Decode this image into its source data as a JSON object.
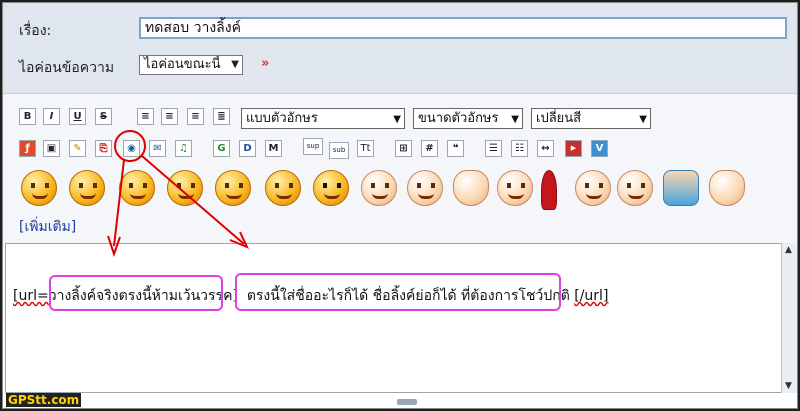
{
  "form": {
    "subject_label": "เรื่อง:",
    "subject_value": "ทดสอบ วางลิ้งค์",
    "icon_label": "ไอค่อนข้อความ",
    "icon_select": "ไอค่อนขณะนี้",
    "collapse_glyph": "»"
  },
  "toolbar": {
    "bold": "B",
    "italic": "I",
    "underline": "U",
    "strike": "S",
    "font_face": "แบบตัวอักษร",
    "font_size": "ขนาดตัวอักษร",
    "font_color": "เปลี่ยนสี",
    "row2_labels": [
      "G",
      "M",
      "sup",
      "sub",
      "Tt",
      "#"
    ]
  },
  "smileys_more": "[เพิ่มเติม]",
  "editor": {
    "open_tag": "[url=",
    "link_part": "วางลิ้งค์จริงตรงนี้ห้ามเว้นวรรค",
    "close_bracket": "]",
    "text_part": "ตรงนี้ใส่ชื่ออะไรก็ได้ ชื่อลิ้งค์ย่อก็ได้ ที่ต้องการโชว์ปกติ",
    "end_tag": "[/url]"
  },
  "watermark": "GPStt.com",
  "colors": {
    "highlight": "#e040e0",
    "arrow": "#e00000"
  }
}
